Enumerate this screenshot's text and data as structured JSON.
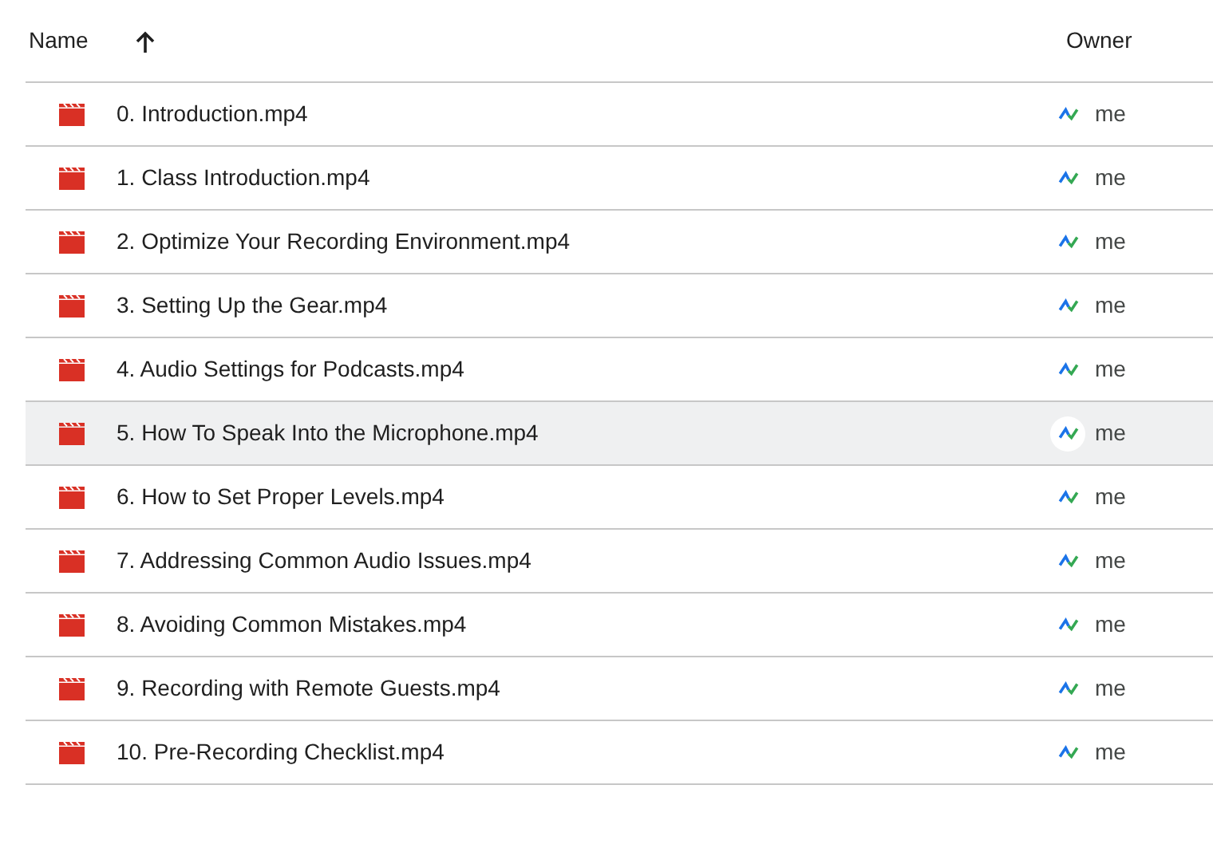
{
  "table": {
    "columns": [
      {
        "label": "Name",
        "sort_ascending": true
      },
      {
        "label": "Owner"
      }
    ],
    "rows": [
      {
        "name": "0. Introduction.mp4",
        "owner": "me",
        "hovered": false
      },
      {
        "name": "1. Class Introduction.mp4",
        "owner": "me",
        "hovered": false
      },
      {
        "name": "2. Optimize Your Recording Environment.mp4",
        "owner": "me",
        "hovered": false
      },
      {
        "name": "3. Setting Up the Gear.mp4",
        "owner": "me",
        "hovered": false
      },
      {
        "name": "4. Audio Settings for Podcasts.mp4",
        "owner": "me",
        "hovered": false
      },
      {
        "name": "5. How To Speak Into the Microphone.mp4",
        "owner": "me",
        "hovered": true
      },
      {
        "name": "6. How to Set Proper Levels.mp4",
        "owner": "me",
        "hovered": false
      },
      {
        "name": "7. Addressing Common Audio Issues.mp4",
        "owner": "me",
        "hovered": false
      },
      {
        "name": "8. Avoiding Common Mistakes.mp4",
        "owner": "me",
        "hovered": false
      },
      {
        "name": "9. Recording with Remote Guests.mp4",
        "owner": "me",
        "hovered": false
      },
      {
        "name": "10. Pre-Recording Checklist.mp4",
        "owner": "me",
        "hovered": false
      }
    ]
  }
}
